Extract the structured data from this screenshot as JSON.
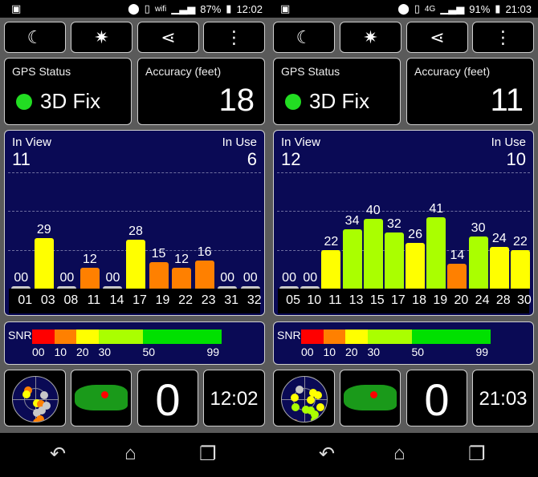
{
  "colors": {
    "gray": "#c8c8c8",
    "red": "#ff0000",
    "orange": "#ff8000",
    "yellow": "#ffff00",
    "yellowgreen": "#aaff00",
    "green": "#00e000",
    "panel": "#0a0a55"
  },
  "phones": [
    {
      "status": {
        "time": "12:02",
        "battery": "87%",
        "network": "wifi",
        "icons": [
          "image-icon",
          "location-icon",
          "vibrate-icon",
          "wifi-icon",
          "signal-icon",
          "battery-icon"
        ]
      },
      "toolbar": {
        "icons": [
          "moon-icon",
          "compass-star-icon",
          "share-icon",
          "more-vert-icon"
        ]
      },
      "gps_status": {
        "label": "GPS Status",
        "value": "3D Fix",
        "indicator_color": "#22dd22"
      },
      "accuracy": {
        "label": "Accuracy (feet)",
        "value": "18"
      },
      "chart_data": {
        "type": "bar",
        "in_view_label": "In View",
        "in_view": "11",
        "in_use_label": "In Use",
        "in_use": "6",
        "categories": [
          "01",
          "03",
          "08",
          "11",
          "14",
          "17",
          "19",
          "22",
          "23",
          "31",
          "32"
        ],
        "values": [
          0,
          29,
          0,
          12,
          0,
          28,
          15,
          12,
          16,
          0,
          0
        ],
        "labels": [
          "00",
          "29",
          "00",
          "12",
          "00",
          "28",
          "15",
          "12",
          "16",
          "00",
          "00"
        ]
      },
      "snr": {
        "label": "SNR",
        "ticks": [
          "00",
          "10",
          "20",
          "30",
          "50",
          "99"
        ]
      },
      "bottom": {
        "count": "0",
        "clock": "12:02"
      },
      "sky": [
        [
          22,
          20,
          "orange"
        ],
        [
          20,
          28,
          "yellow"
        ],
        [
          40,
          46,
          "yellow"
        ],
        [
          48,
          48,
          "orange"
        ],
        [
          50,
          62,
          "gray"
        ],
        [
          40,
          66,
          "gray"
        ],
        [
          46,
          80,
          "orange"
        ],
        [
          40,
          86,
          "orange"
        ],
        [
          55,
          30,
          "gray"
        ],
        [
          60,
          52,
          "gray"
        ],
        [
          53,
          95,
          "gray"
        ]
      ]
    },
    {
      "status": {
        "time": "21:03",
        "battery": "91%",
        "network": "4G",
        "icons": [
          "image-icon",
          "location-icon",
          "vibrate-icon",
          "4g-icon",
          "signal-icon",
          "battery-icon"
        ]
      },
      "toolbar": {
        "icons": [
          "moon-icon",
          "compass-star-icon",
          "share-icon",
          "more-vert-icon"
        ]
      },
      "gps_status": {
        "label": "GPS Status",
        "value": "3D Fix",
        "indicator_color": "#22dd22"
      },
      "accuracy": {
        "label": "Accuracy (feet)",
        "value": "11"
      },
      "chart_data": {
        "type": "bar",
        "in_view_label": "In View",
        "in_view": "12",
        "in_use_label": "In Use",
        "in_use": "10",
        "categories": [
          "05",
          "10",
          "11",
          "13",
          "15",
          "17",
          "18",
          "19",
          "20",
          "24",
          "28",
          "30"
        ],
        "values": [
          0,
          0,
          22,
          34,
          40,
          32,
          26,
          41,
          14,
          30,
          24,
          22
        ],
        "labels": [
          "00",
          "00",
          "22",
          "34",
          "40",
          "32",
          "26",
          "41",
          "14",
          "30",
          "24",
          "22"
        ]
      },
      "snr": {
        "label": "SNR",
        "ticks": [
          "00",
          "10",
          "20",
          "30",
          "50",
          "99"
        ]
      },
      "bottom": {
        "count": "0",
        "clock": "21:03"
      },
      "sky": [
        [
          28,
          18,
          "gray"
        ],
        [
          18,
          35,
          "yellow"
        ],
        [
          20,
          55,
          "yellowgreen"
        ],
        [
          40,
          60,
          "yellowgreen"
        ],
        [
          18,
          88,
          "orange"
        ],
        [
          50,
          62,
          "yellowgreen"
        ],
        [
          58,
          70,
          "yellowgreen"
        ],
        [
          58,
          82,
          "yellowgreen"
        ],
        [
          45,
          95,
          "gray"
        ],
        [
          55,
          25,
          "yellow"
        ],
        [
          50,
          40,
          "yellow"
        ],
        [
          70,
          55,
          "yellow"
        ],
        [
          65,
          30,
          "yellow"
        ]
      ]
    }
  ],
  "navbar": {
    "icons": [
      "back-icon",
      "home-icon",
      "recents-icon"
    ]
  }
}
